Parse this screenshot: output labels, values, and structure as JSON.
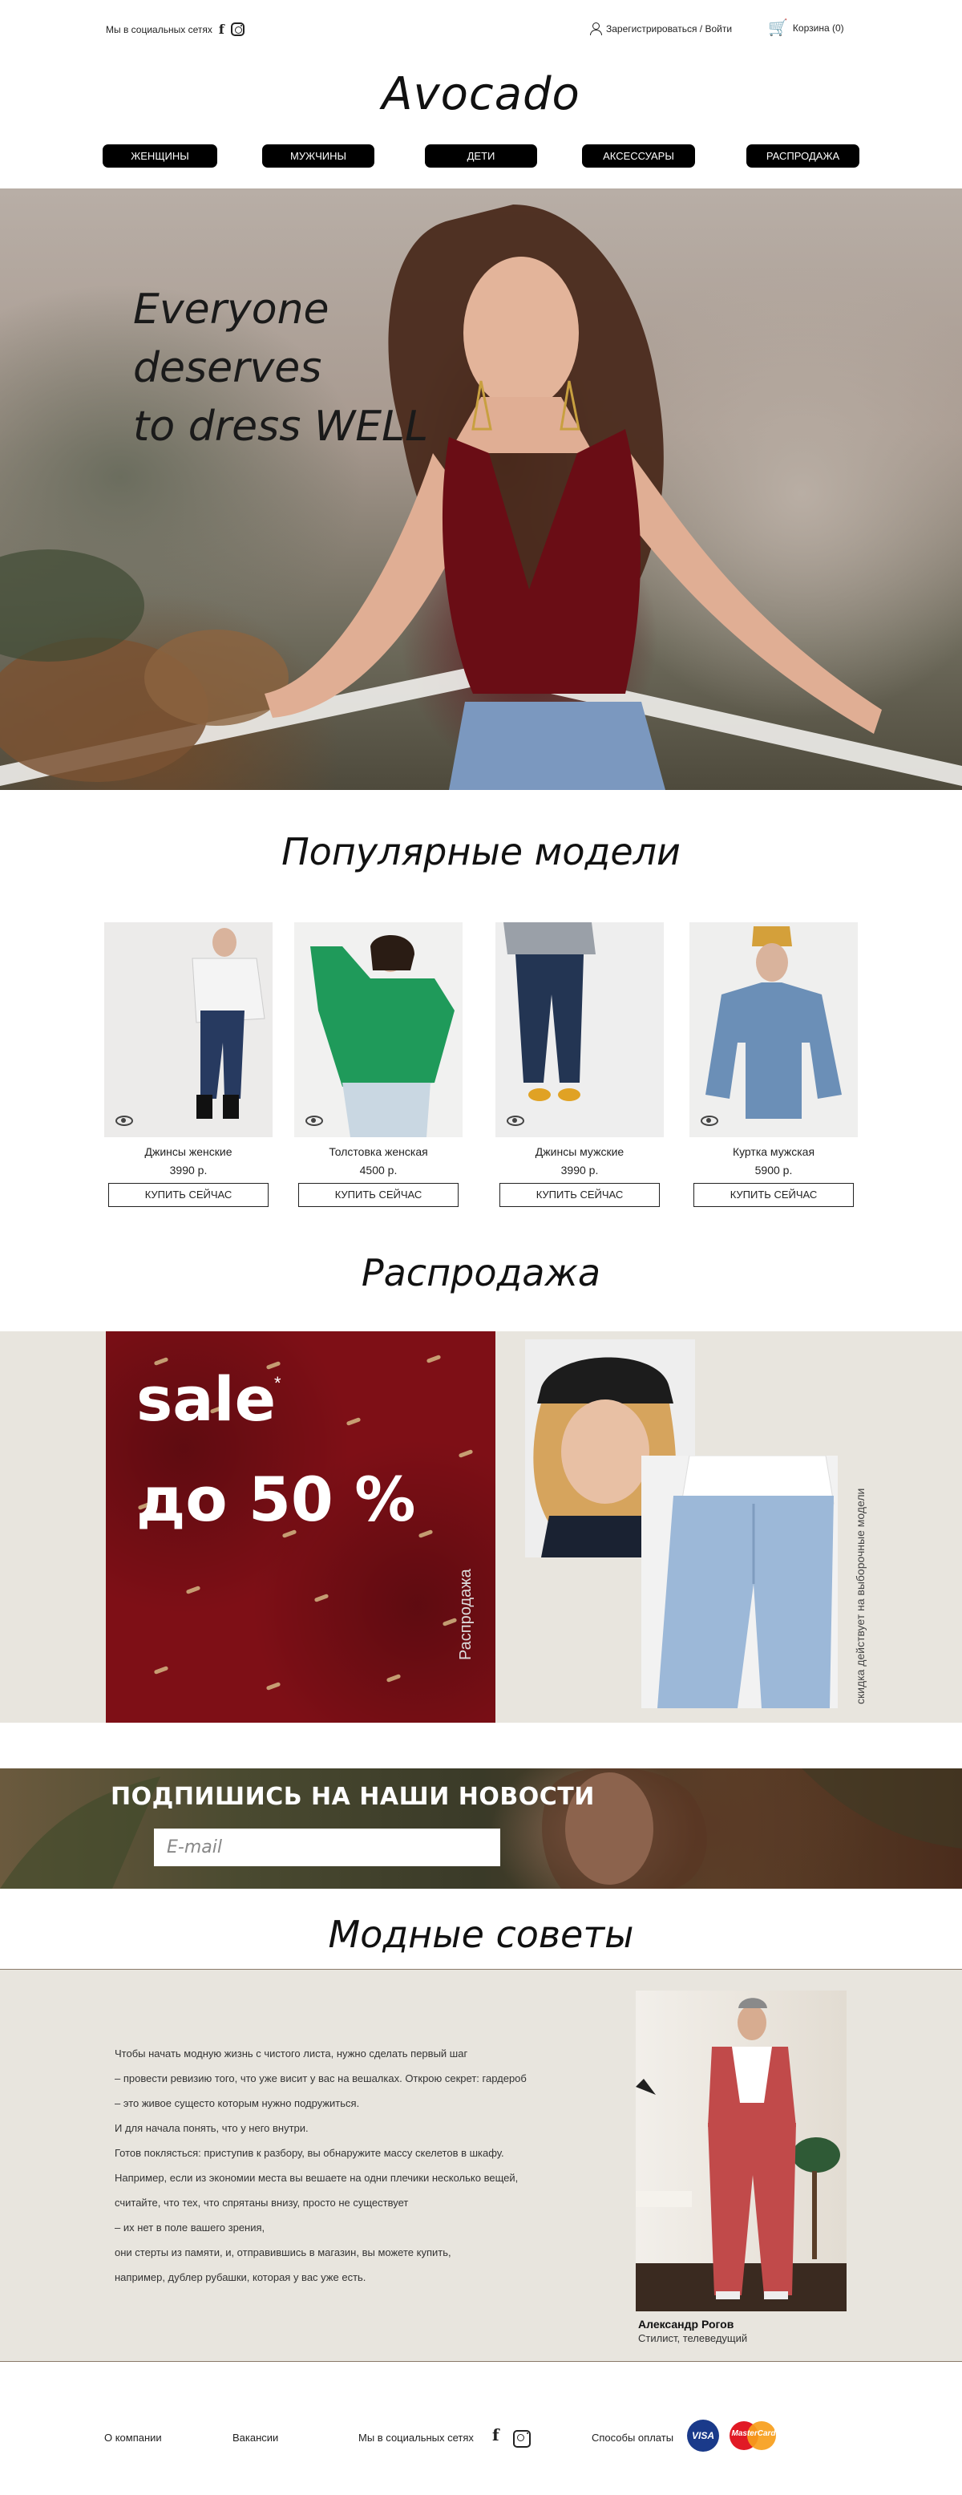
{
  "header": {
    "social_label": "Мы в социальных сетях",
    "login_label": "Зарегистрироваться / Войти",
    "cart_label": "Корзина (0)",
    "logo": "Avocado"
  },
  "nav": [
    {
      "label": "Женщины"
    },
    {
      "label": "Мужчины"
    },
    {
      "label": "Дети"
    },
    {
      "label": "Аксессуары"
    },
    {
      "label": "Распродажа"
    }
  ],
  "hero": {
    "line1": "Everyone",
    "line2": "deserves",
    "line3": "to dress WELL"
  },
  "popular": {
    "title": "Популярные модели",
    "buy_label": "Купить сейчас",
    "items": [
      {
        "name": "Джинсы женские",
        "price": "3990 р."
      },
      {
        "name": "Толстовка женская",
        "price": "4500 р."
      },
      {
        "name": "Джинсы мужские",
        "price": "3990 р."
      },
      {
        "name": "Куртка мужская",
        "price": "5900 р."
      }
    ]
  },
  "sale": {
    "title": "Распродажа",
    "word": "sale",
    "star": "*",
    "percent": "до 50 %",
    "vertical_label": "Распродажа",
    "note": "скидка действует на выборочные модели"
  },
  "subscribe": {
    "title": "ПОДПИШИСЬ НА НАШИ НОВОСТИ",
    "placeholder": "E-mail"
  },
  "tips": {
    "title": "Модные советы",
    "paragraphs": [
      "Чтобы начать модную жизнь  с чистого листа, нужно сделать первый шаг",
      "– провести ревизию того, что уже висит у вас на вешалках. Открою секрет: гардероб",
      "– это живое сущесто которым нужно подружиться.",
      "И для начала понять, что у него внутри.",
      " Готов поклясться: приступив к разбору, вы обнаружите массу скелетов в шкафу.",
      "Например, если из экономии места вы вешаете на одни плечики несколько вещей,",
      "считайте, что тех, что спрятаны внизу, просто не существует",
      " – их нет в поле вашего зрения,",
      "они стерты из памяти, и, отправившись в магазин, вы можете купить,",
      "например, дублер рубашки, которая у вас уже есть."
    ],
    "author_name": "Александр Рогов",
    "author_role": "Стилист, телеведущий"
  },
  "footer": {
    "about": "О компании",
    "jobs": "Вакансии",
    "social_label": "Мы в социальных сетях",
    "payment_label": "Способы оплаты",
    "visa": "VISA",
    "mastercard": "MasterCard"
  },
  "colors": {
    "sale_red": "#7e0f16",
    "band_beige": "#e8e5de",
    "nav_black": "#000000"
  }
}
